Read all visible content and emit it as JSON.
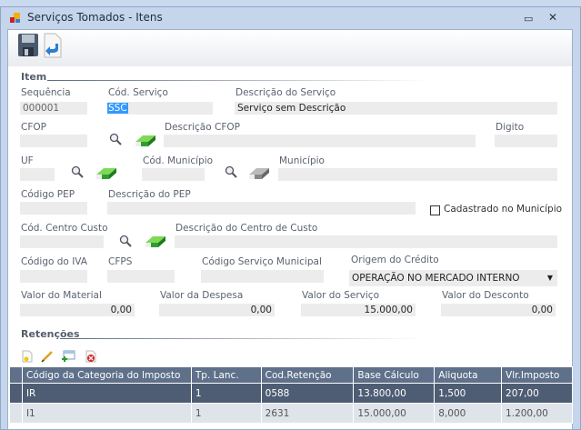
{
  "window": {
    "title": "Serviços Tomados - Itens",
    "minimize": "▭",
    "close": "✕"
  },
  "toolbar": {
    "save": "save-icon",
    "back": "return-icon"
  },
  "item": {
    "section": "Item",
    "sequencia": {
      "label": "Sequência",
      "value": "000001"
    },
    "cod_servico": {
      "label": "Cód. Serviço",
      "value": "SSC"
    },
    "descricao_servico": {
      "label": "Descrição do Serviço",
      "value": "Serviço sem Descrição"
    },
    "cfop": {
      "label": "CFOP",
      "value": ""
    },
    "descricao_cfop": {
      "label": "Descrição CFOP",
      "value": ""
    },
    "digito": {
      "label": "Digito",
      "value": ""
    },
    "uf": {
      "label": "UF",
      "value": ""
    },
    "cod_municipio": {
      "label": "Cód. Município",
      "value": ""
    },
    "municipio": {
      "label": "Município",
      "value": ""
    },
    "codigo_pep": {
      "label": "Código PEP",
      "value": ""
    },
    "descricao_pep": {
      "label": "Descrição do PEP",
      "value": ""
    },
    "cadastrado_municipio": {
      "label": "Cadastrado no Município",
      "checked": false
    },
    "centro_custo": {
      "label": "Cód. Centro Custo",
      "value": ""
    },
    "descricao_centro_custo": {
      "label": "Descrição do Centro de Custo",
      "value": ""
    },
    "codigo_iva": {
      "label": "Código do IVA",
      "value": ""
    },
    "cfps": {
      "label": "CFPS",
      "value": ""
    },
    "cod_serv_municipal": {
      "label": "Código Serviço Municipal",
      "value": ""
    },
    "origem_credito": {
      "label": "Origem do Crédito",
      "value": "OPERAÇÃO NO MERCADO INTERNO"
    },
    "valor_material": {
      "label": "Valor do Material",
      "value": "0,00"
    },
    "valor_despesa": {
      "label": "Valor da Despesa",
      "value": "0,00"
    },
    "valor_servico": {
      "label": "Valor do Serviço",
      "value": "15.000,00"
    },
    "valor_desconto": {
      "label": "Valor do Desconto",
      "value": "0,00"
    }
  },
  "retencoes": {
    "section": "Retenções",
    "columns": [
      "Código da Categoria do Imposto",
      "Tp. Lanc.",
      "Cod.Retenção",
      "Base Cálculo",
      "Aliquota",
      "Vlr.Imposto"
    ],
    "rows": [
      [
        "IR",
        "1",
        "0588",
        "13.800,00",
        "1,500",
        "207,00"
      ],
      [
        "I1",
        "1",
        "2631",
        "15.000,00",
        "8,000",
        "1.200,00"
      ]
    ]
  }
}
